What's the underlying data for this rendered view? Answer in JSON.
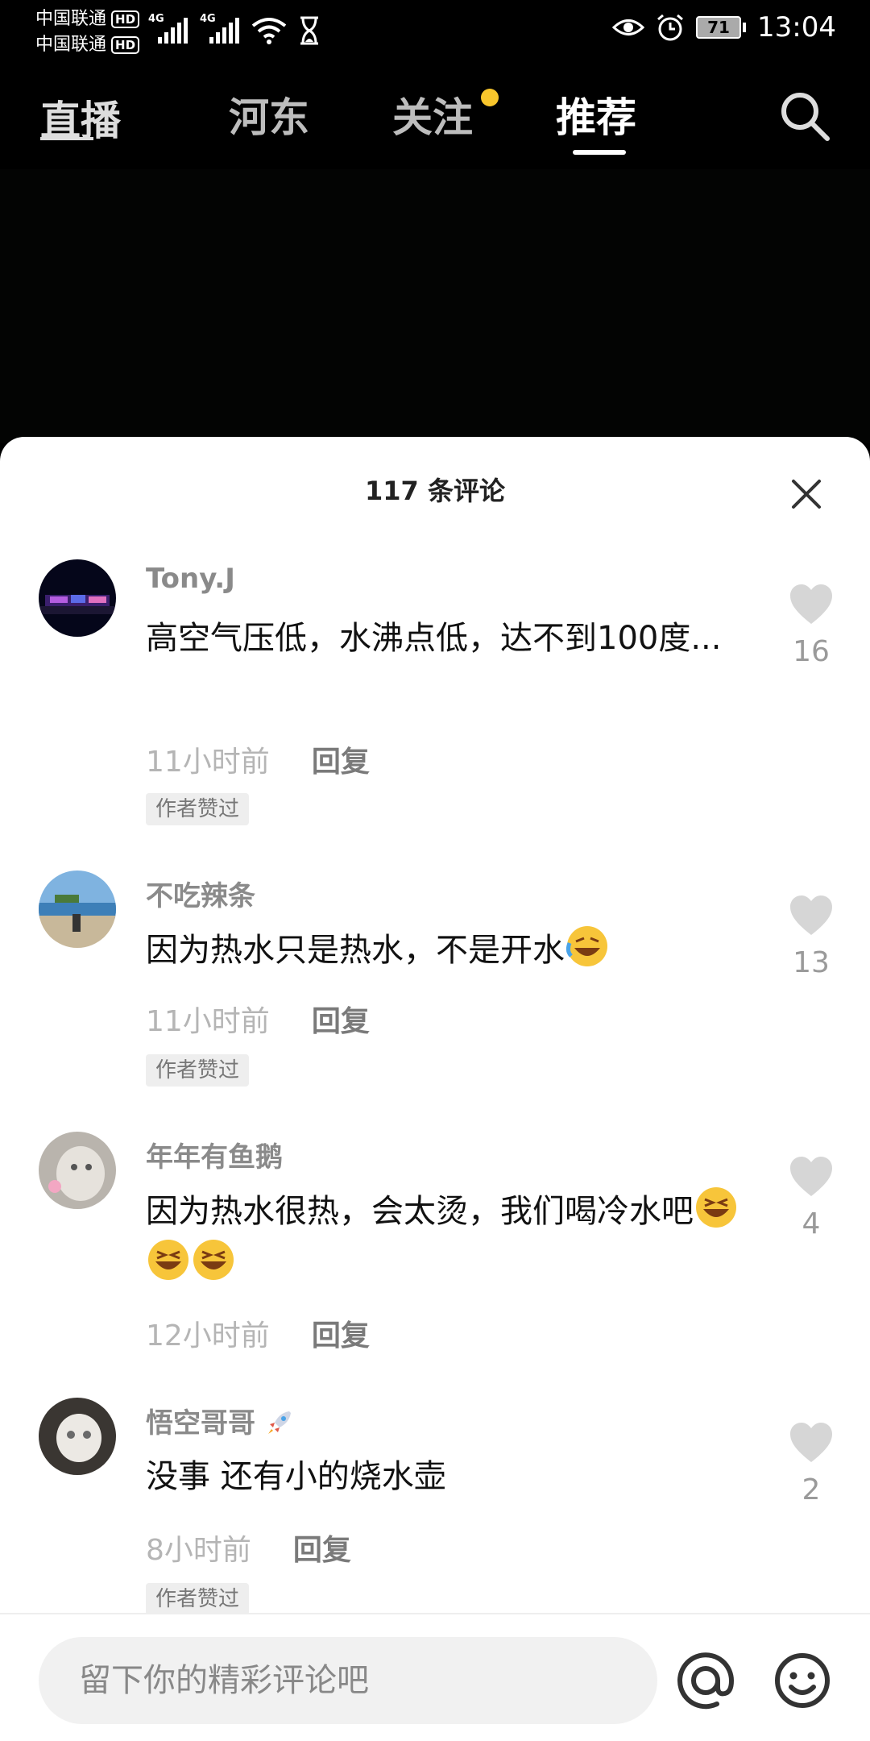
{
  "status_bar": {
    "carrier1": "中国联通",
    "carrier2": "中国联通",
    "hd": "HD",
    "network": "4G",
    "battery": "71",
    "time": "13:04"
  },
  "nav": {
    "live": "直播",
    "tabs": [
      {
        "label": "河东"
      },
      {
        "label": "关注"
      },
      {
        "label": "推荐"
      }
    ]
  },
  "comments_panel": {
    "title": "117 条评论",
    "comments": [
      {
        "user": "Tony.J",
        "text": "高空气压低，水沸点低，达不到100度...",
        "time": "11小时前",
        "reply": "回复",
        "badge": "作者赞过",
        "likes": "16"
      },
      {
        "user": "不吃辣条",
        "text": "因为热水只是热水，不是开水",
        "time": "11小时前",
        "reply": "回复",
        "badge": "作者赞过",
        "likes": "13"
      },
      {
        "user": "年年有鱼鹅",
        "text": "因为热水很热，会太烫，我们喝冷水吧",
        "time": "12小时前",
        "reply": "回复",
        "likes": "4"
      },
      {
        "user": "悟空哥哥",
        "text": "没事 还有小的烧水壶",
        "time": "8小时前",
        "reply": "回复",
        "badge": "作者赞过",
        "likes": "2"
      }
    ]
  },
  "input": {
    "placeholder": "留下你的精彩评论吧"
  },
  "colors": {
    "follow_dot": "#f8c62c",
    "sheet_bg": "#ffffff",
    "page_bg": "#000000"
  }
}
